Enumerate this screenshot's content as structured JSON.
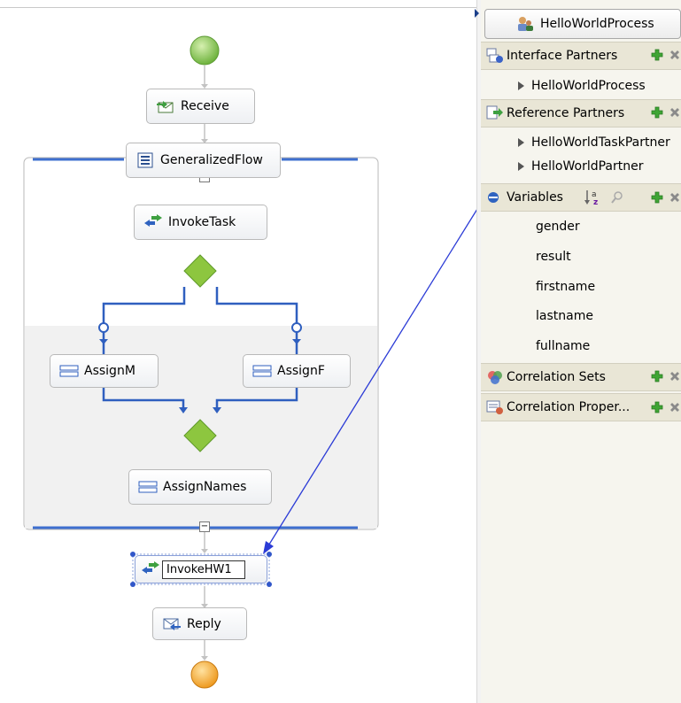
{
  "flow": {
    "receive": "Receive",
    "generalized_flow": "GeneralizedFlow",
    "collapse_symbol": "−",
    "invoke_task": "InvokeTask",
    "assign_m": "AssignM",
    "assign_f": "AssignF",
    "assign_names": "AssignNames",
    "invoke_hw1": "InvokeHW1",
    "reply": "Reply"
  },
  "panel": {
    "process_button": "HelloWorldProcess",
    "interface_partners": {
      "header": "Interface Partners",
      "items": [
        "HelloWorldProcess"
      ]
    },
    "reference_partners": {
      "header": "Reference Partners",
      "items": [
        "HelloWorldTaskPartner",
        "HelloWorldPartner"
      ]
    },
    "variables": {
      "header": "Variables",
      "items": [
        "gender",
        "result",
        "firstname",
        "lastname",
        "fullname"
      ]
    },
    "correlation_sets": {
      "header": "Correlation Sets"
    },
    "correlation_properties": {
      "header": "Correlation Proper..."
    }
  },
  "colors": {
    "start_event": "#7cc04a",
    "end_event": "#f2a531",
    "gateway": "#8dc63f",
    "flow_line": "#2f5fbf",
    "link_arrow": "#2b3bd6"
  }
}
